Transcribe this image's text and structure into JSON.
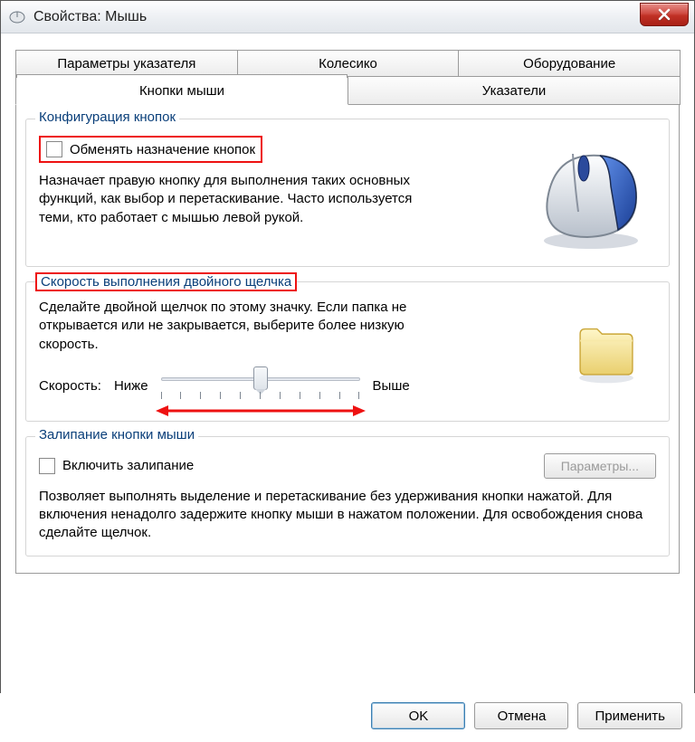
{
  "window": {
    "title": "Свойства: Мышь",
    "close_aria": "Закрыть"
  },
  "tabs": {
    "top": [
      "Параметры указателя",
      "Колесико",
      "Оборудование"
    ],
    "bottom": [
      "Кнопки мыши",
      "Указатели"
    ],
    "active": "Кнопки мыши"
  },
  "group_buttons": {
    "legend": "Конфигурация кнопок",
    "checkbox_label": "Обменять назначение кнопок",
    "checked": false,
    "description": "Назначает правую кнопку для выполнения таких основных функций, как выбор и перетаскивание. Часто используется теми, кто работает с мышью левой рукой."
  },
  "group_dblclick": {
    "legend": "Скорость выполнения двойного щелчка",
    "description": "Сделайте двойной щелчок по этому значку. Если папка не открывается или не закрывается, выберите более низкую скорость.",
    "speed_label": "Скорость:",
    "low_label": "Ниже",
    "high_label": "Выше",
    "value_percent": 50
  },
  "group_clicklock": {
    "legend": "Залипание кнопки мыши",
    "checkbox_label": "Включить залипание",
    "checked": false,
    "params_button": "Параметры...",
    "params_enabled": false,
    "description": "Позволяет выполнять выделение и перетаскивание без удерживания кнопки нажатой. Для включения ненадолго задержите кнопку мыши в нажатом положении. Для освобождения снова сделайте щелчок."
  },
  "buttons": {
    "ok": "OK",
    "cancel": "Отмена",
    "apply": "Применить"
  }
}
